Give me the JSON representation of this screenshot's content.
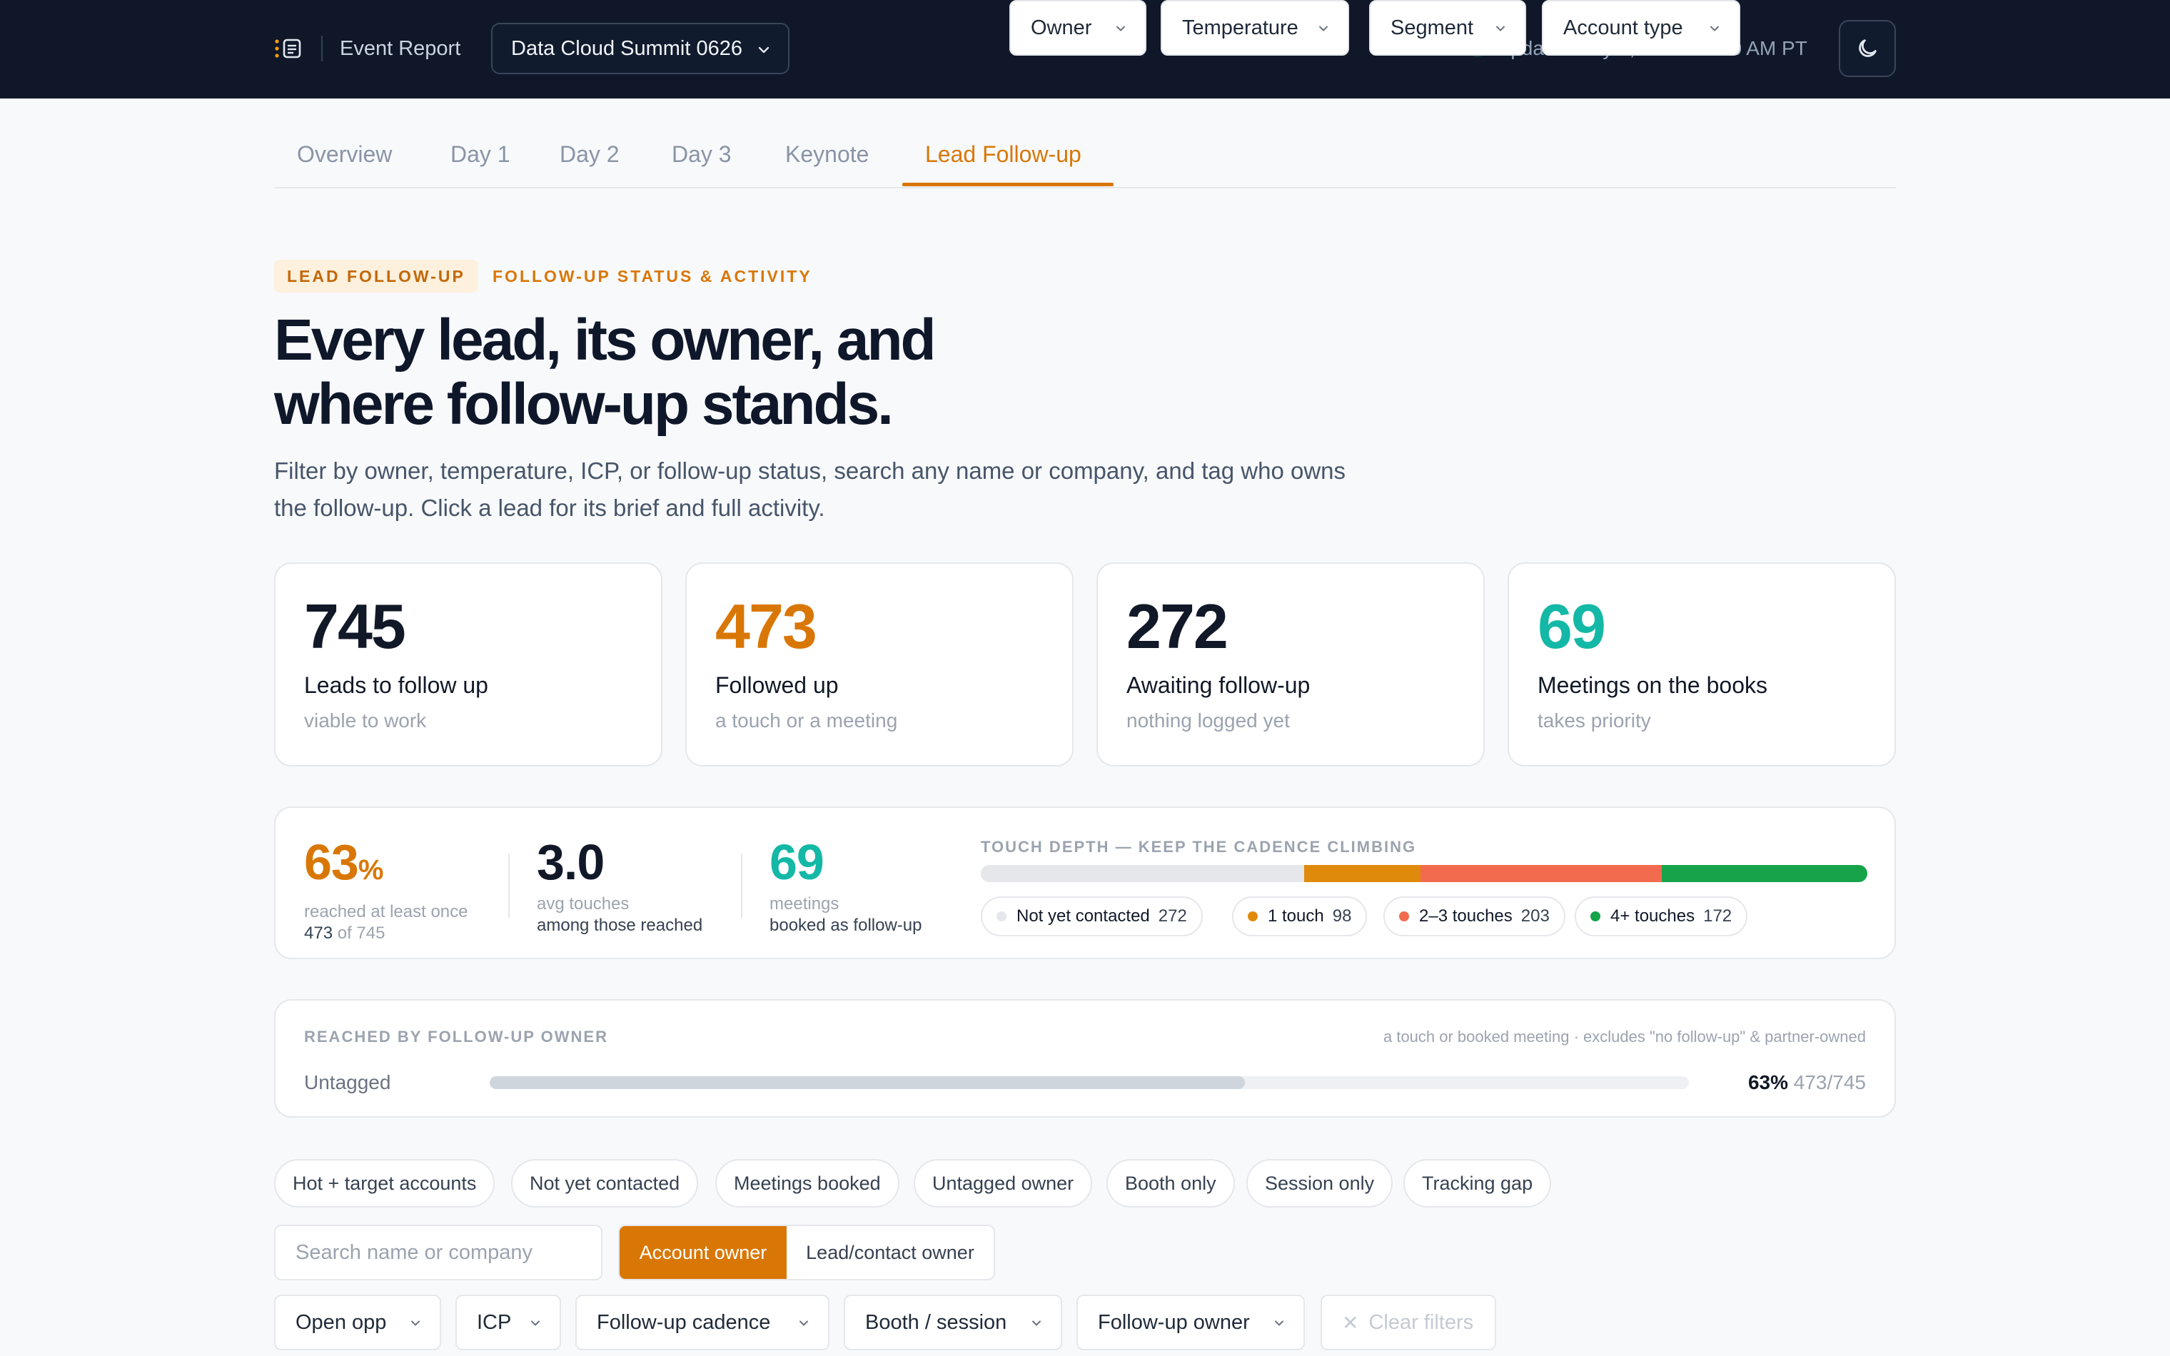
{
  "header": {
    "brand_icon": "report-list-icon",
    "title": "Event Report",
    "event_select": "Data Cloud Summit 0626",
    "updated": "Updated July 8, 2026 · 9:40 AM PT",
    "status_color": "#22c55e",
    "theme_icon": "moon-icon"
  },
  "tabs": [
    {
      "label": "Overview"
    },
    {
      "label": "Day 1"
    },
    {
      "label": "Day 2"
    },
    {
      "label": "Day 3"
    },
    {
      "label": "Keynote"
    },
    {
      "label": "Lead Follow-up",
      "active": true
    }
  ],
  "hero": {
    "badge": "LEAD FOLLOW-UP",
    "eyebrow": "FOLLOW-UP STATUS & ACTIVITY",
    "title": "Every lead, its owner, and where follow-up stands.",
    "description": "Filter by owner, temperature, ICP, or follow-up status, search any name or company, and tag who owns the follow-up. Click a lead for its brief and full activity."
  },
  "stats": [
    {
      "value": "745",
      "label": "Leads to follow up",
      "sub": "viable to work",
      "color": "#111827"
    },
    {
      "value": "473",
      "label": "Followed up",
      "sub": "a touch or a meeting",
      "color": "#d97706"
    },
    {
      "value": "272",
      "label": "Awaiting follow-up",
      "sub": "nothing logged yet",
      "color": "#111827"
    },
    {
      "value": "69",
      "label": "Meetings on the books",
      "sub": "takes priority",
      "color": "#14b8a6"
    }
  ],
  "summary": {
    "reached": {
      "value": "63",
      "unit": "%",
      "l1": "reached at least once",
      "count": "473",
      "of": "of 745"
    },
    "avg": {
      "value": "3.0",
      "l1": "avg touches",
      "l2": "among those reached"
    },
    "meetings": {
      "value": "69",
      "l1": "meetings",
      "l2": "booked as follow-up"
    },
    "touch_title": "TOUCH DEPTH — KEEP THE CADENCE CLIMBING",
    "touch_total": 745,
    "touch": [
      {
        "label": "Not yet contacted",
        "count": "272",
        "value": 272,
        "color": "#e5e7eb"
      },
      {
        "label": "1 touch",
        "count": "98",
        "value": 98,
        "color": "#e08a0b"
      },
      {
        "label": "2–3 touches",
        "count": "203",
        "value": 203,
        "color": "#f26b4f"
      },
      {
        "label": "4+ touches",
        "count": "172",
        "value": 172,
        "color": "#16a34a"
      }
    ]
  },
  "owner": {
    "title": "REACHED BY FOLLOW-UP OWNER",
    "note": "a touch or booked meeting · excludes \"no follow-up\" & partner-owned",
    "rows": [
      {
        "label": "Untagged",
        "fraction": 0.63,
        "pct": "63%",
        "count": "473/745"
      }
    ]
  },
  "quick_filters": [
    "Hot + target accounts",
    "Not yet contacted",
    "Meetings booked",
    "Untagged owner",
    "Booth only",
    "Session only",
    "Tracking gap"
  ],
  "filters": {
    "search_placeholder": "Search name or company",
    "toggle": [
      "Account owner",
      "Lead/contact owner"
    ],
    "row1": [
      "Owner",
      "Temperature",
      "Segment",
      "Account type"
    ],
    "row2": [
      "Open opp",
      "ICP",
      "Follow-up cadence",
      "Booth / session",
      "Follow-up owner"
    ],
    "clear": "Clear filters"
  }
}
